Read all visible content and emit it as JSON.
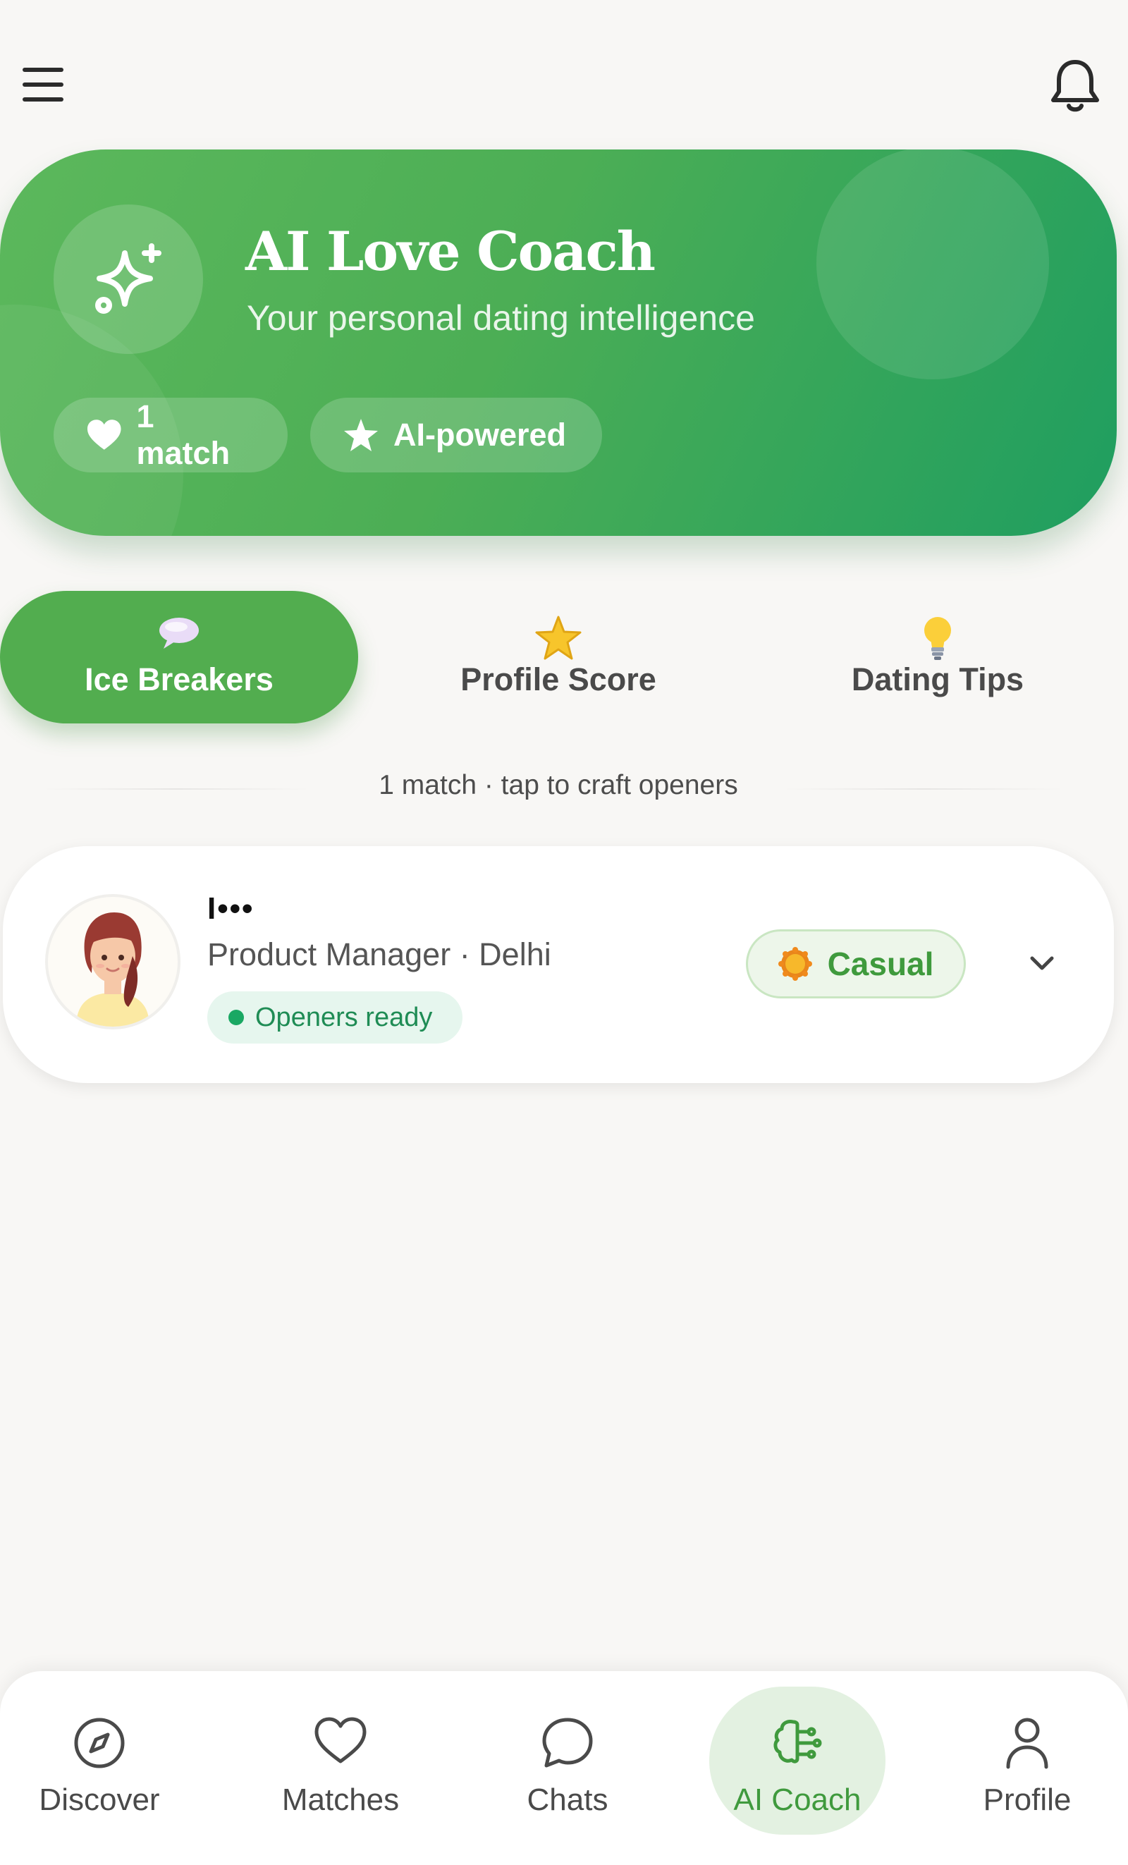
{
  "colors": {
    "accent": "#52ad4f",
    "hero_start": "#5cb85c",
    "hero_end": "#1f9e60",
    "openers_green": "#1aa863",
    "background": "#f8f7f5"
  },
  "topbar": {
    "menu_icon": "hamburger-menu-icon",
    "notification_icon": "bell-icon"
  },
  "hero": {
    "icon": "sparkles-icon",
    "title": "AI Love Coach",
    "subtitle": "Your personal dating intelligence",
    "chips": [
      {
        "icon": "heart-icon",
        "label": "1 match"
      },
      {
        "icon": "star-icon",
        "label": "AI-powered"
      }
    ]
  },
  "tabs": [
    {
      "icon": "speech-bubble-icon",
      "label": "Ice Breakers",
      "active": true
    },
    {
      "icon": "star-icon",
      "label": "Profile Score",
      "active": false
    },
    {
      "icon": "lightbulb-icon",
      "label": "Dating Tips",
      "active": false
    }
  ],
  "section_note": "1 match · tap to craft openers",
  "match": {
    "name": "I•••",
    "meta": "Product Manager · Delhi",
    "openers_status": "Openers ready",
    "vibe": {
      "icon": "sun-icon",
      "label": "Casual"
    },
    "expand_icon": "chevron-down-icon"
  },
  "bottom_nav": [
    {
      "icon": "compass-icon",
      "label": "Discover",
      "active": false
    },
    {
      "icon": "heart-outline-icon",
      "label": "Matches",
      "active": false
    },
    {
      "icon": "chat-bubble-icon",
      "label": "Chats",
      "active": false
    },
    {
      "icon": "brain-icon",
      "label": "AI Coach",
      "active": true
    },
    {
      "icon": "user-icon",
      "label": "Profile",
      "active": false
    }
  ]
}
